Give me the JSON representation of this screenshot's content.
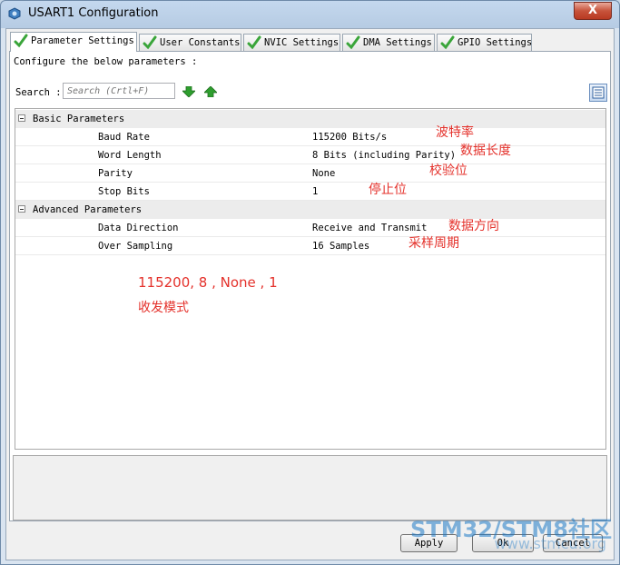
{
  "window": {
    "title": "USART1 Configuration",
    "close_label": "X"
  },
  "tabs": [
    {
      "label": "Parameter Settings"
    },
    {
      "label": "User Constants"
    },
    {
      "label": "NVIC Settings"
    },
    {
      "label": "DMA Settings"
    },
    {
      "label": "GPIO Settings"
    }
  ],
  "panel": {
    "configure_label": "Configure the below parameters :",
    "search_label": "Search :",
    "search_placeholder": "Search (Crtl+F)"
  },
  "groups": [
    {
      "name": "Basic Parameters",
      "params": [
        {
          "name": "Baud Rate",
          "value": "115200 Bits/s"
        },
        {
          "name": "Word Length",
          "value": "8 Bits (including Parity)"
        },
        {
          "name": "Parity",
          "value": "None"
        },
        {
          "name": "Stop Bits",
          "value": "1"
        }
      ]
    },
    {
      "name": "Advanced Parameters",
      "params": [
        {
          "name": "Data Direction",
          "value": "Receive and Transmit"
        },
        {
          "name": "Over Sampling",
          "value": "16 Samples"
        }
      ]
    }
  ],
  "annotations": {
    "baud": "波特率",
    "word": "数据长度",
    "parity": "校验位",
    "stop": "停止位",
    "direction": "数据方向",
    "sampling": "采样周期",
    "summary_line1": "115200, 8 , None , 1",
    "summary_line2": "收发模式"
  },
  "buttons": {
    "apply": "Apply",
    "ok": "Ok",
    "cancel": "Cancel"
  },
  "watermark": {
    "line1": "STM32/STM8社区",
    "line2": "www.stmcu.org"
  },
  "colors": {
    "annotation": "#e4312b",
    "check": "#3aa53a",
    "arrow": "#2e9e2e"
  }
}
